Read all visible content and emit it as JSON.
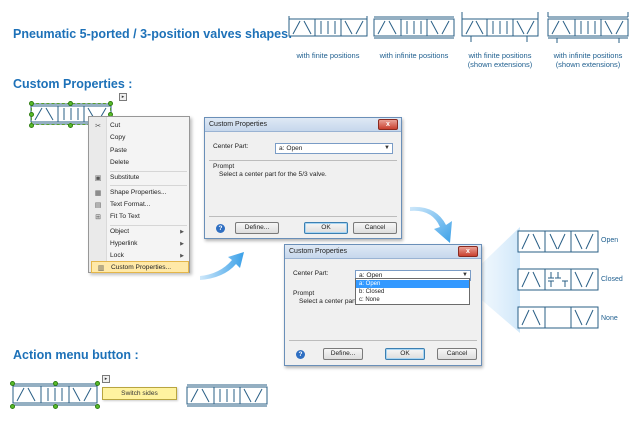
{
  "section1": {
    "title": "Pneumatic 5-ported / 3-position valves shapes:",
    "captions": [
      "with finite positions",
      "with infinite positions",
      "with finite positions\n(shown extensions)",
      "with infinite positions\n(shown extensions)"
    ]
  },
  "section2": {
    "title": "Custom Properties :",
    "menu": [
      {
        "label": "Cut",
        "icon": "✂"
      },
      {
        "label": "Copy",
        "icon": ""
      },
      {
        "label": "Paste",
        "icon": ""
      },
      {
        "label": "Delete",
        "icon": ""
      },
      {
        "label": "Substitute",
        "icon": "▣"
      },
      {
        "label": "Shape Properties...",
        "icon": "▦"
      },
      {
        "label": "Text Format...",
        "icon": "▤"
      },
      {
        "label": "Fit To Text",
        "icon": "⊞"
      },
      {
        "label": "Object",
        "icon": "",
        "submenu": true
      },
      {
        "label": "Hyperlink",
        "icon": "",
        "submenu": true
      },
      {
        "label": "Lock",
        "icon": "",
        "submenu": true
      },
      {
        "label": "Custom Properties...",
        "icon": "▥",
        "highlighted": true
      }
    ],
    "dialog1": {
      "title": "Custom Properties",
      "field_label": "Center Part:",
      "field_value": "a: Open",
      "prompt_label": "Prompt",
      "prompt_text": "Select a center part for the 5/3 valve.",
      "define_label": "Define...",
      "ok_label": "OK",
      "cancel_label": "Cancel"
    },
    "dialog2": {
      "title": "Custom Properties",
      "field_label": "Center Part:",
      "field_value": "a: Open",
      "prompt_label": "Prompt",
      "prompt_text": "Select a center part fo",
      "options": [
        "a: Open",
        "b: Closed",
        "c: None"
      ],
      "define_label": "Define...",
      "ok_label": "OK",
      "cancel_label": "Cancel"
    },
    "results": [
      "Open",
      "Closed",
      "None"
    ]
  },
  "section3": {
    "title": "Action menu button :",
    "tooltip": "Switch sides"
  },
  "colors": {
    "heading": "#1d71b8",
    "valve_stroke": "#2a5f86",
    "selection_handle": "#5bbd2b",
    "menu_highlight": "#ffe9a8",
    "arrow_gradient": "#3aa0e8"
  }
}
